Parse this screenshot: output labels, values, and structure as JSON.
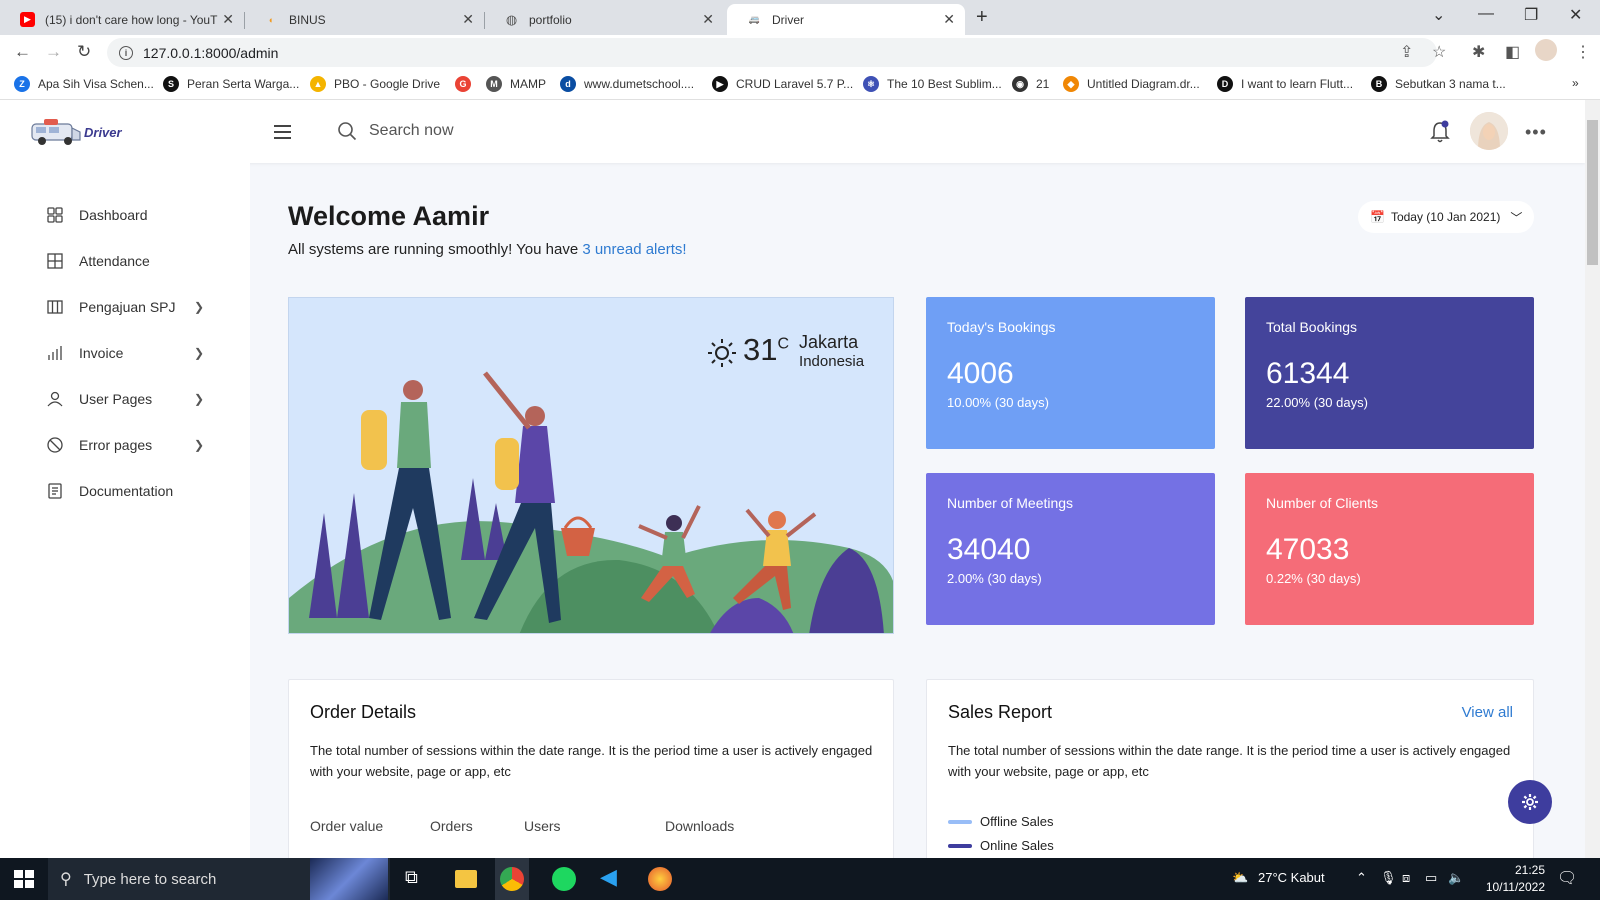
{
  "browser": {
    "tabs": [
      {
        "label": "(15) i don't care how long - YouT"
      },
      {
        "label": "BINUS"
      },
      {
        "label": "portfolio"
      },
      {
        "label": "Driver"
      }
    ],
    "url": "127.0.0.1:8000/admin",
    "bookmarks": [
      {
        "label": "Apa Sih Visa Schen...",
        "color": "#1a73e8",
        "glyph": "Z"
      },
      {
        "label": "Peran Serta Warga...",
        "color": "#111111",
        "glyph": "S"
      },
      {
        "label": "PBO - Google Drive",
        "color": "#f4b400",
        "glyph": "▲"
      },
      {
        "label": "",
        "color": "#ea4335",
        "glyph": "G"
      },
      {
        "label": "MAMP",
        "color": "#555555",
        "glyph": "M"
      },
      {
        "label": "www.dumetschool....",
        "color": "#0a4da2",
        "glyph": "d"
      },
      {
        "label": "CRUD Laravel 5.7 P...",
        "color": "#111111",
        "glyph": "▶"
      },
      {
        "label": "The 10 Best Sublim...",
        "color": "#3f51b5",
        "glyph": "⚛"
      },
      {
        "label": "21",
        "color": "#333333",
        "glyph": "◉"
      },
      {
        "label": "Untitled Diagram.dr...",
        "color": "#f08705",
        "glyph": "◆"
      },
      {
        "label": "I want to learn Flutt...",
        "color": "#111111",
        "glyph": "D"
      },
      {
        "label": "Sebutkan 3 nama t...",
        "color": "#111111",
        "glyph": "B"
      }
    ]
  },
  "app": {
    "logo_text": "Driver",
    "search_placeholder": "Search now",
    "sidebar": [
      {
        "label": "Dashboard",
        "icon": "grid-icon",
        "chevron": false
      },
      {
        "label": "Attendance",
        "icon": "table-icon",
        "chevron": false
      },
      {
        "label": "Pengajuan SPJ",
        "icon": "columns-icon",
        "chevron": true
      },
      {
        "label": "Invoice",
        "icon": "bar-chart-icon",
        "chevron": true
      },
      {
        "label": "User Pages",
        "icon": "user-icon",
        "chevron": true
      },
      {
        "label": "Error pages",
        "icon": "ban-icon",
        "chevron": true
      },
      {
        "label": "Documentation",
        "icon": "document-icon",
        "chevron": false
      }
    ],
    "welcome_title": "Welcome Aamir",
    "subtitle_text": "All systems are running smoothly! You have ",
    "subtitle_link": "3 unread alerts!",
    "date_label": "Today (10 Jan 2021)",
    "weather": {
      "temp": "31",
      "unit": "C",
      "city": "Jakarta",
      "country": "Indonesia"
    },
    "stats": [
      {
        "label": "Today's Bookings",
        "value": "4006",
        "change": "10.00% (30 days)",
        "color": "#6f9ff5"
      },
      {
        "label": "Total Bookings",
        "value": "61344",
        "change": "22.00% (30 days)",
        "color": "#44449b"
      },
      {
        "label": "Number of Meetings",
        "value": "34040",
        "change": "2.00% (30 days)",
        "color": "#7471e4"
      },
      {
        "label": "Number of Clients",
        "value": "47033",
        "change": "0.22% (30 days)",
        "color": "#f56c78"
      }
    ],
    "order_card": {
      "title": "Order Details",
      "desc": "The total number of sessions within the date range. It is the period time a user is actively engaged with your website, page or app, etc",
      "columns": [
        "Order value",
        "Orders",
        "Users",
        "Downloads"
      ]
    },
    "sales_card": {
      "title": "Sales Report",
      "view_all": "View all",
      "desc": "The total number of sessions within the date range. It is the period time a user is actively engaged with your website, page or app, etc",
      "legend": [
        {
          "label": "Offline Sales",
          "color": "#98bdf7"
        },
        {
          "label": "Online Sales",
          "color": "#3e3d9e"
        }
      ]
    }
  },
  "taskbar": {
    "search_placeholder": "Type here to search",
    "weather": "27°C  Kabut",
    "time": "21:25",
    "date": "10/11/2022"
  }
}
